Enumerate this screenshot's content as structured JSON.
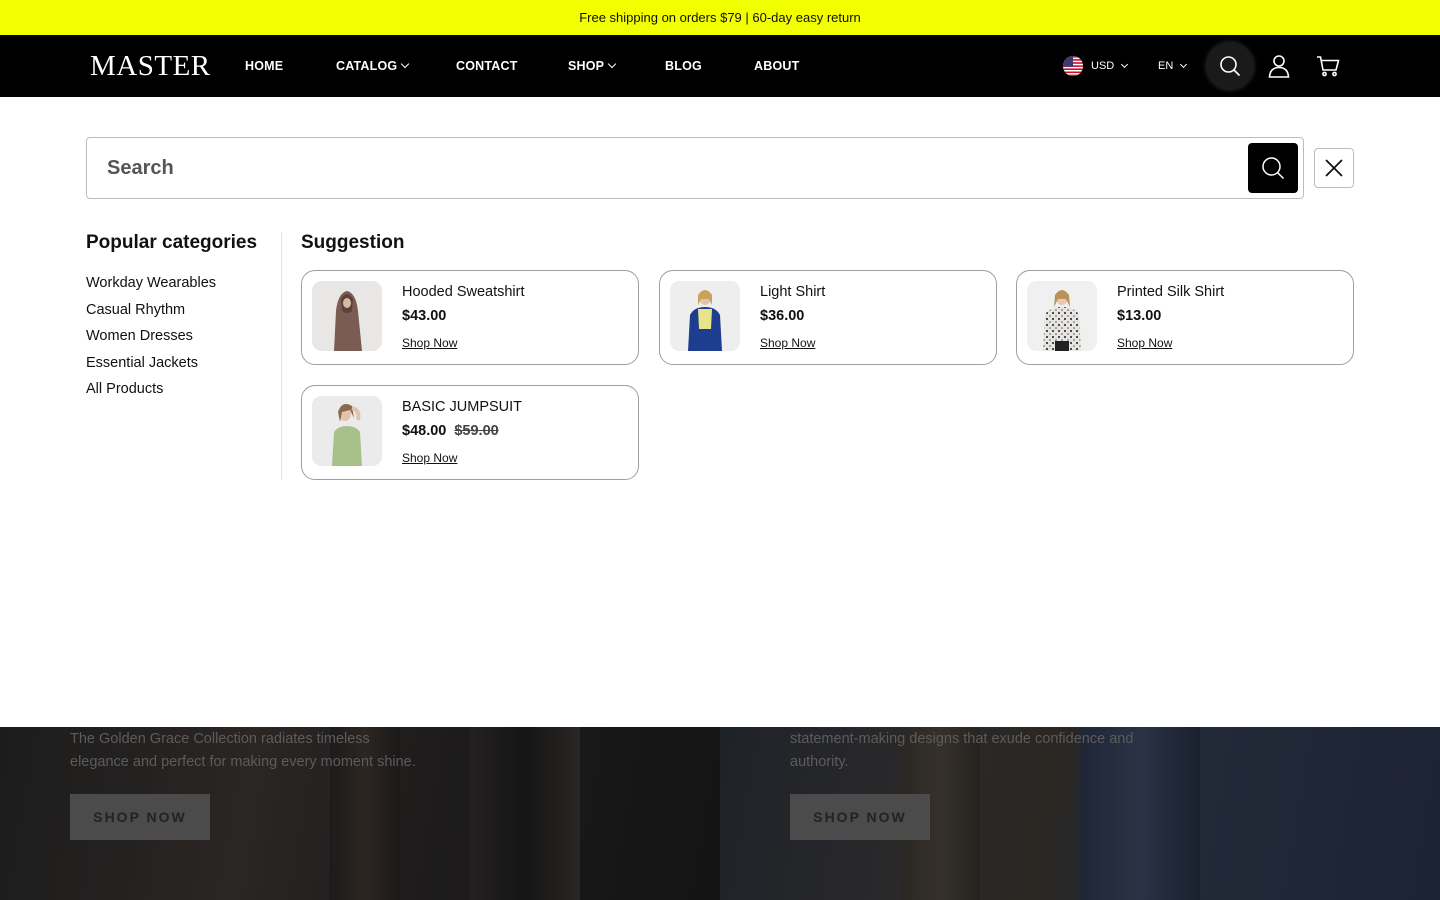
{
  "announcement": {
    "text": "Free shipping on orders $79 | 60-day easy return"
  },
  "header": {
    "logo": "MASTER",
    "nav": [
      {
        "label": "HOME",
        "has_dropdown": false
      },
      {
        "label": "CATALOG",
        "has_dropdown": true
      },
      {
        "label": "CONTACT",
        "has_dropdown": false
      },
      {
        "label": "SHOP",
        "has_dropdown": true
      },
      {
        "label": "BLOG",
        "has_dropdown": false
      },
      {
        "label": "ABOUT",
        "has_dropdown": false
      }
    ],
    "currency": {
      "selected": "USD",
      "flag_icon": "us-flag-icon"
    },
    "language": {
      "selected": "EN"
    },
    "icons": [
      "search-icon",
      "user-icon",
      "cart-icon"
    ]
  },
  "search": {
    "placeholder": "Search",
    "value": ""
  },
  "categories": {
    "title": "Popular categories",
    "items": [
      "Workday Wearables",
      "Casual Rhythm",
      "Women Dresses",
      "Essential Jackets",
      "All Products"
    ]
  },
  "suggestions": {
    "title": "Suggestion",
    "products": [
      {
        "name": "Hooded Sweatshirt",
        "price": "$43.00",
        "compare_price": "",
        "link": "Shop Now"
      },
      {
        "name": "Light Shirt",
        "price": "$36.00",
        "compare_price": "",
        "link": "Shop Now"
      },
      {
        "name": "Printed Silk Shirt",
        "price": "$13.00",
        "compare_price": "",
        "link": "Shop Now"
      },
      {
        "name": "BASIC JUMPSUIT",
        "price": "$48.00",
        "compare_price": "$59.00",
        "link": "Shop Now"
      }
    ]
  },
  "hero": {
    "left": {
      "text_1": "The Golden Grace Collection radiates timeless",
      "text_2": "elegance and perfect for making every moment shine.",
      "button": "SHOP NOW"
    },
    "right": {
      "text_1": "statement-making designs that exude confidence and",
      "text_2": "authority.",
      "button": "SHOP NOW"
    }
  },
  "colors": {
    "announcement_bg": "#f2ff00",
    "header_bg": "#000000",
    "accent": "#000000"
  }
}
